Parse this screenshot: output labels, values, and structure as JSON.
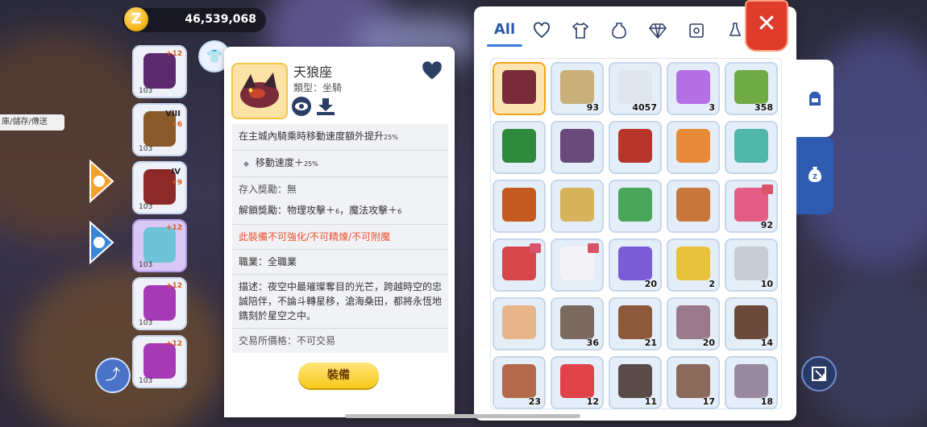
{
  "currency": {
    "amount": "46,539,068",
    "icon": "zeny-coin-icon",
    "symbol": "Z"
  },
  "side_info": {
    "text": "庫/儲存/傳送"
  },
  "equip_slots": [
    {
      "level": "103",
      "plus": "+12",
      "tier": "",
      "color": "#5b2a6e",
      "style": "normal"
    },
    {
      "level": "103",
      "plus": "+6",
      "tier": "VIII",
      "color": "#8a5a2b",
      "style": "normal"
    },
    {
      "level": "103",
      "plus": "+9",
      "tier": "IV",
      "color": "#8c2a2a",
      "style": "normal"
    },
    {
      "level": "103",
      "plus": "+12",
      "tier": "",
      "color": "#6ec3d6",
      "style": "purple"
    },
    {
      "level": "103",
      "plus": "+12",
      "tier": "",
      "color": "#a43bb5",
      "style": "normal"
    },
    {
      "level": "103",
      "plus": "+12",
      "tier": "",
      "color": "#a43bb5",
      "style": "normal"
    }
  ],
  "item_detail": {
    "name": "天狼座",
    "type": "類型：坐騎",
    "effect": "在主城內騎乘時移動速度額外提升",
    "effect_value": "25%",
    "stat_label": "移動速度＋",
    "stat_value": "25%",
    "deposit_reward": "存入獎勵：無",
    "unlock_reward_prefix": "解鎖獎勵：物理攻擊＋",
    "unlock_reward_v1": "6",
    "unlock_reward_mid": "，魔法攻擊＋",
    "unlock_reward_v2": "6",
    "restriction": "此裝備不可強化/不可精煉/不可附魔",
    "job": "職業：全職業",
    "description": "描述：夜空中最璀璨奪目的光芒，跨越時空的忠誠陪伴，不論斗轉星移，滄海桑田，都將永恆地鐫刻於星空之中。",
    "trade_price": "交易所價格：不可交易",
    "equip_button": "裝備"
  },
  "inventory": {
    "tabs": [
      {
        "label": "All",
        "icon": "",
        "active": true
      },
      {
        "label": "",
        "icon": "heart-icon",
        "active": false
      },
      {
        "label": "",
        "icon": "shirt-icon",
        "active": false
      },
      {
        "label": "",
        "icon": "potion-bag-icon",
        "active": false
      },
      {
        "label": "",
        "icon": "diamond-icon",
        "active": false
      },
      {
        "label": "",
        "icon": "card-icon",
        "active": false
      },
      {
        "label": "",
        "icon": "misc-icon",
        "active": false
      }
    ],
    "close_label": "✕",
    "items": [
      {
        "qty": "",
        "color": "#7a2b3a",
        "selected": true,
        "badge": false
      },
      {
        "qty": "93",
        "color": "#c9b07a",
        "selected": false,
        "badge": false
      },
      {
        "qty": "4057",
        "color": "#dfe6ee",
        "selected": false,
        "badge": false
      },
      {
        "qty": "3",
        "color": "#b46ee6",
        "selected": false,
        "badge": false
      },
      {
        "qty": "358",
        "color": "#6faa45",
        "selected": false,
        "badge": false
      },
      {
        "qty": "",
        "color": "#2f8a3e",
        "selected": false,
        "badge": false
      },
      {
        "qty": "",
        "color": "#6a4a7a",
        "selected": false,
        "badge": false
      },
      {
        "qty": "",
        "color": "#b8352c",
        "selected": false,
        "badge": false
      },
      {
        "qty": "",
        "color": "#e68a3a",
        "selected": false,
        "badge": false
      },
      {
        "qty": "",
        "color": "#4fb6a8",
        "selected": false,
        "badge": false
      },
      {
        "qty": "",
        "color": "#c45a1e",
        "selected": false,
        "badge": false
      },
      {
        "qty": "",
        "color": "#d6b35a",
        "selected": false,
        "badge": false
      },
      {
        "qty": "",
        "color": "#49a55a",
        "selected": false,
        "badge": false
      },
      {
        "qty": "",
        "color": "#c8773a",
        "selected": false,
        "badge": false
      },
      {
        "qty": "92",
        "color": "#e35d86",
        "selected": false,
        "badge": true
      },
      {
        "qty": "",
        "color": "#d6464a",
        "selected": false,
        "badge": true
      },
      {
        "qty": "",
        "color": "#f4f4f6",
        "selected": false,
        "badge": true
      },
      {
        "qty": "20",
        "color": "#7b5bd6",
        "selected": false,
        "badge": false
      },
      {
        "qty": "2",
        "color": "#e8c23a",
        "selected": false,
        "badge": false
      },
      {
        "qty": "10",
        "color": "#c9cdd6",
        "selected": false,
        "badge": false
      },
      {
        "qty": "",
        "color": "#e8b48a",
        "selected": false,
        "badge": false
      },
      {
        "qty": "36",
        "color": "#7a6a60",
        "selected": false,
        "badge": false
      },
      {
        "qty": "21",
        "color": "#8a5a3a",
        "selected": false,
        "badge": false
      },
      {
        "qty": "20",
        "color": "#9a7a8a",
        "selected": false,
        "badge": false
      },
      {
        "qty": "14",
        "color": "#6a4a3a",
        "selected": false,
        "badge": false
      },
      {
        "qty": "23",
        "color": "#b46a4a",
        "selected": false,
        "badge": false
      },
      {
        "qty": "12",
        "color": "#e0434a",
        "selected": false,
        "badge": false
      },
      {
        "qty": "11",
        "color": "#5a4a48",
        "selected": false,
        "badge": false
      },
      {
        "qty": "17",
        "color": "#8a6a5a",
        "selected": false,
        "badge": false
      },
      {
        "qty": "18",
        "color": "#9a8aa0",
        "selected": false,
        "badge": false
      }
    ]
  },
  "side_tabs": [
    {
      "icon": "backpack-icon",
      "active": true
    },
    {
      "icon": "zeny-bag-icon",
      "active": false
    }
  ]
}
